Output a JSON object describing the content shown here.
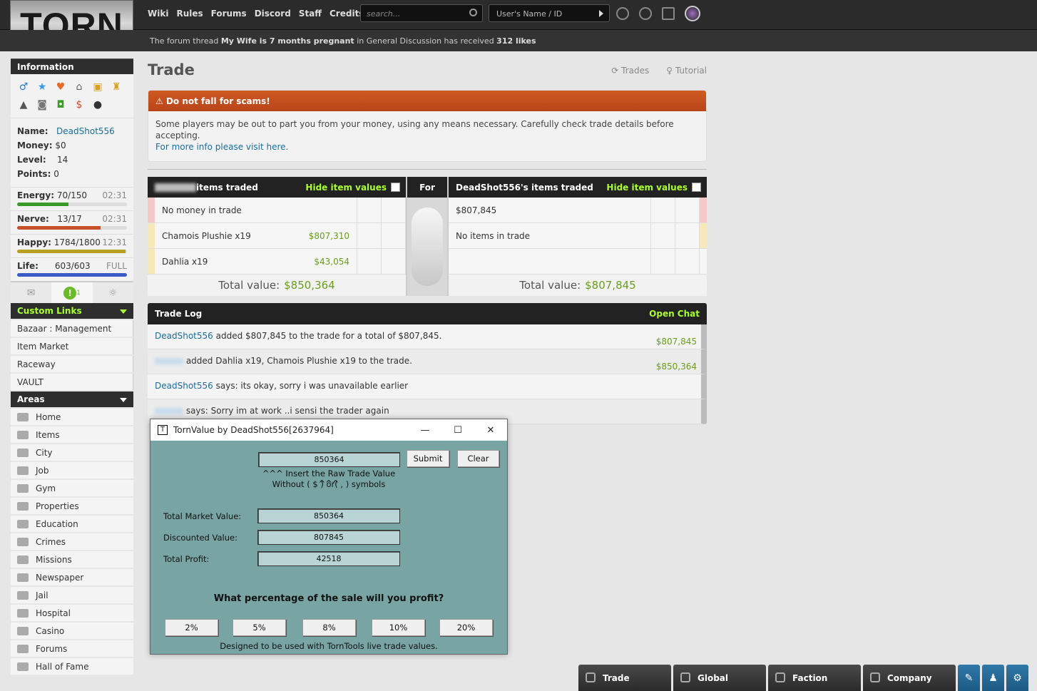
{
  "logo": "TORN",
  "topnav": [
    "Wiki",
    "Rules",
    "Forums",
    "Discord",
    "Staff",
    "Credits"
  ],
  "search": {
    "placeholder": "search..."
  },
  "user_lookup": {
    "placeholder": "User's Name / ID"
  },
  "news": {
    "prefix": "The forum thread",
    "thread": "My Wife is 7 months pregnant",
    "mid": "in General Discussion has received",
    "count": "312 likes"
  },
  "sidebar": {
    "info_title": "Information",
    "name_label": "Name:",
    "name": "DeadShot556",
    "money_label": "Money:",
    "money": "$0",
    "level_label": "Level:",
    "level": "14",
    "points_label": "Points:",
    "points": "0",
    "bars": [
      {
        "label": "Energy:",
        "value": "70/150",
        "time": "02:31",
        "fraction": 0.47,
        "color": "#3a9a2a"
      },
      {
        "label": "Nerve:",
        "value": "13/17",
        "time": "02:31",
        "fraction": 0.76,
        "color": "#c8502a"
      },
      {
        "label": "Happy:",
        "value": "1784/1800",
        "time": "12:31",
        "fraction": 0.99,
        "color": "#b8a020"
      },
      {
        "label": "Life:",
        "value": "603/603",
        "time": "FULL",
        "fraction": 1.0,
        "color": "#3a5ac8"
      }
    ],
    "events_count": "1",
    "custom_links_title": "Custom Links",
    "custom_links": [
      "Bazaar : Management",
      "Item Market",
      "Raceway",
      "VAULT"
    ],
    "areas_title": "Areas",
    "areas": [
      "Home",
      "Items",
      "City",
      "Job",
      "Gym",
      "Properties",
      "Education",
      "Crimes",
      "Missions",
      "Newspaper",
      "Jail",
      "Hospital",
      "Casino",
      "Forums",
      "Hall of Fame"
    ]
  },
  "page": {
    "title": "Trade",
    "links": [
      "Trades",
      "Tutorial"
    ],
    "scam_title": "Do not fall for scams!",
    "scam_text": "Some players may be out to part you from your money, using any means necessary. Carefully check trade details before accepting.",
    "scam_link": "For more info please visit here."
  },
  "trade": {
    "left_title": "items traded",
    "hide_label": "Hide item values",
    "for_label": "For",
    "right_title": "DeadShot556's items traded",
    "left_rows": [
      {
        "text": "No money in trade",
        "value": ""
      },
      {
        "text": "Chamois Plushie x19",
        "value": "$807,310"
      },
      {
        "text": "Dahlia x19",
        "value": "$43,054"
      }
    ],
    "right_rows": [
      {
        "text": "$807,845",
        "value": ""
      },
      {
        "text": "No items in trade",
        "value": ""
      },
      {
        "text": "",
        "value": ""
      }
    ],
    "total_label": "Total value:",
    "left_total": "$850,364",
    "right_total": "$807,845"
  },
  "log": {
    "title": "Trade Log",
    "open_chat": "Open Chat",
    "rows": [
      {
        "user": "DeadShot556",
        "text": "added $807,845 to the trade for a total of $807,845.",
        "value": "$807,845"
      },
      {
        "user": "",
        "text": "added Dahlia x19, Chamois Plushie x19 to the trade.",
        "value": "$850,364"
      },
      {
        "user": "DeadShot556",
        "text": "says: its okay, sorry i was unavailable earlier",
        "value": ""
      },
      {
        "user": "",
        "text": "says: Sorry im at work ..i sensi the trader again",
        "value": ""
      }
    ]
  },
  "tornvalue": {
    "title": "TornValue by DeadShot556[2637964]",
    "raw_value": "850364",
    "submit": "Submit",
    "clear": "Clear",
    "hint1": "^^^ Insert the Raw Trade Value ^^^",
    "hint2": "Without ( $ ) or( , ) symbols",
    "market_label": "Total Market Value:",
    "market": "850364",
    "discount_label": "Discounted Value:",
    "discount": "807845",
    "profit_label": "Total Profit:",
    "profit": "42518",
    "question": "What percentage of the sale will you profit?",
    "pcts": [
      "2%",
      "5%",
      "8%",
      "10%",
      "20%"
    ],
    "footer": "Designed to be used with TornTools live trade values."
  },
  "bottom_tabs": [
    "Trade",
    "Global",
    "Faction",
    "Company"
  ]
}
